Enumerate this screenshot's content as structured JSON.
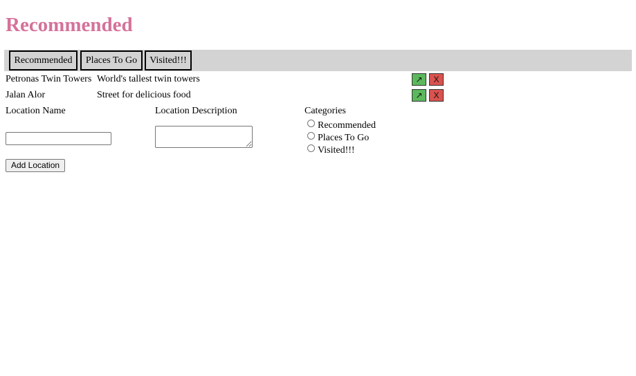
{
  "page": {
    "title": "Recommended"
  },
  "nav": {
    "tabs": [
      {
        "label": "Recommended"
      },
      {
        "label": "Places To Go"
      },
      {
        "label": "Visited!!!"
      }
    ]
  },
  "locations": [
    {
      "name": "Petronas Twin Towers",
      "description": "World's tallest twin towers",
      "move_label": "↗",
      "delete_label": "X"
    },
    {
      "name": "Jalan Alor",
      "description": "Street for delicious food",
      "move_label": "↗",
      "delete_label": "X"
    }
  ],
  "form": {
    "name_label": "Location Name",
    "name_value": "",
    "description_label": "Location Description",
    "description_value": "",
    "categories_label": "Categories",
    "categories": [
      {
        "label": "Recommended",
        "selected": false
      },
      {
        "label": "Places To Go",
        "selected": false
      },
      {
        "label": "Visited!!!",
        "selected": false
      }
    ],
    "submit_label": "Add Location"
  },
  "colors": {
    "title": "#d4729a",
    "navbar": "#d3d3d3",
    "move_button": "#5cb85c",
    "delete_button": "#d9534f"
  }
}
